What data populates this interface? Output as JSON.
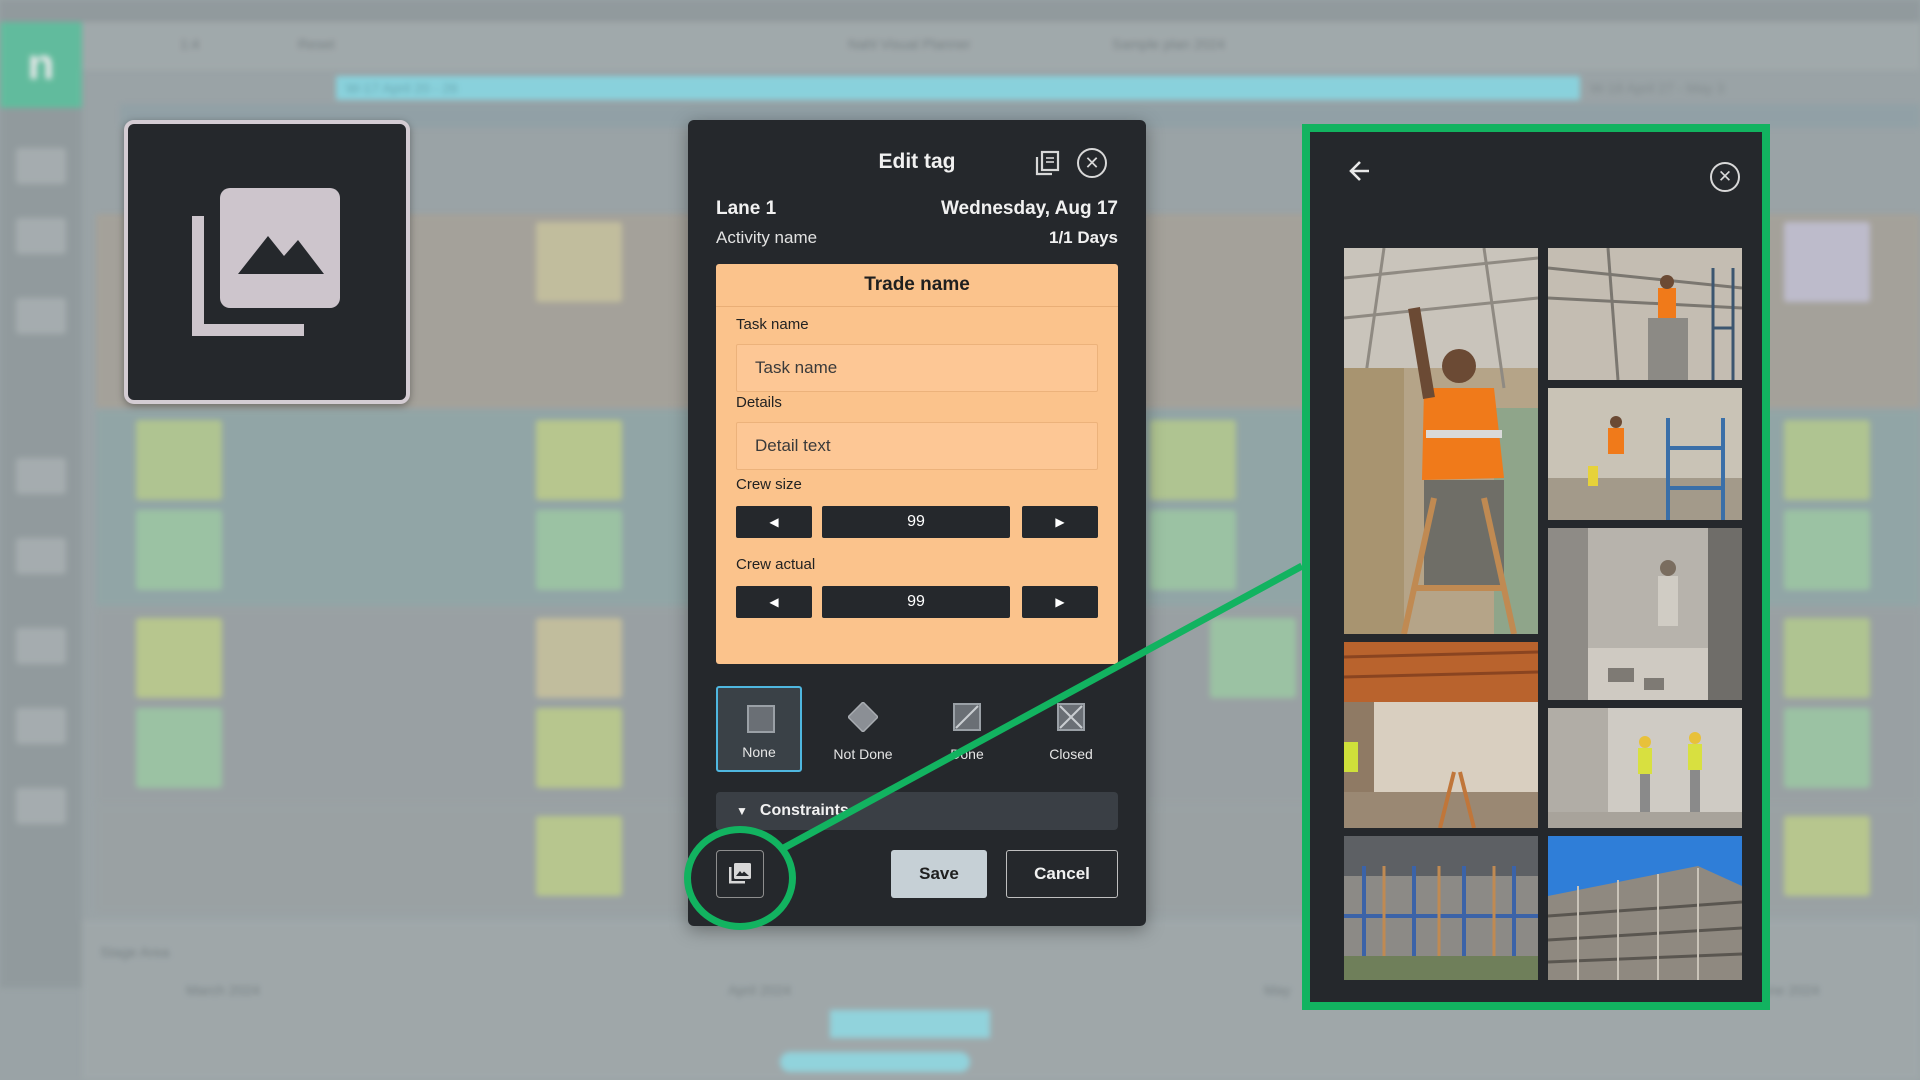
{
  "background_planner": {
    "logo_letter": "n",
    "toolbar": {
      "zoom_value": "1:4",
      "reset_label": "Reset",
      "app_title": "Nahl Visual Planner",
      "plan_name": "Sample plan 2024"
    },
    "week_label_1": "W-17 April 20 - 26",
    "week_label_2": "W-18 April 27 - May 3",
    "area_label": "Stage Area",
    "months": [
      "March 2024",
      "April 2024",
      "May",
      "June 2024"
    ]
  },
  "edit_tag": {
    "title": "Edit tag",
    "lane": "Lane 1",
    "date": "Wednesday, Aug 17",
    "activity_name": "Activity name",
    "days_value": "1/1",
    "days_unit": "Days",
    "trade_name": "Trade name",
    "task_name_label": "Task name",
    "task_name_placeholder": "Task name",
    "details_label": "Details",
    "details_placeholder": "Detail text",
    "crew_size_label": "Crew size",
    "crew_size_value": "99",
    "crew_actual_label": "Crew actual",
    "crew_actual_value": "99",
    "status_options": [
      "None",
      "Not Done",
      "Done",
      "Closed"
    ],
    "status_selected": "None",
    "constraints_label": "Constraints",
    "save_label": "Save",
    "cancel_label": "Cancel",
    "trade_color": "#fbc38c"
  },
  "gallery": {
    "photo_count": 8,
    "highlight_color": "#12b360"
  },
  "icons": [
    "gallery-icon",
    "copy-icon",
    "close-icon",
    "back-arrow-icon",
    "caret-left-icon",
    "caret-right-icon",
    "caret-down-icon"
  ]
}
